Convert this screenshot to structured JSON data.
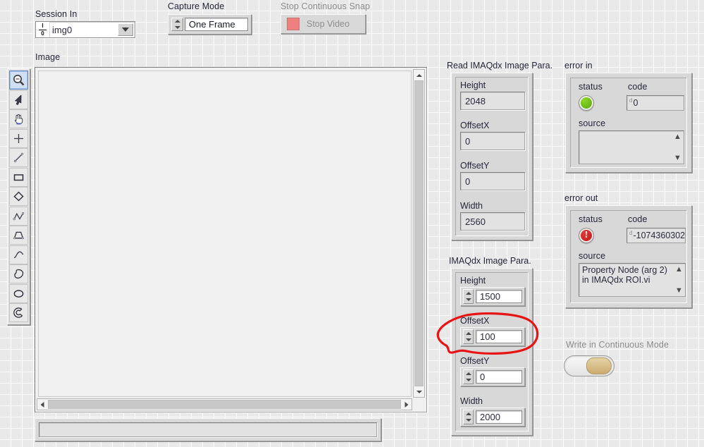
{
  "top_controls": {
    "session": {
      "label": "Session In",
      "value": "img0",
      "glyph": "io-refnum-icon",
      "dropdown_icon": "chevron-down-icon"
    },
    "capture_mode": {
      "label": "Capture Mode",
      "value": "One Frame",
      "increment_icon": "spinner-up-icon",
      "decrement_icon": "spinner-down-icon"
    },
    "stop_snap": {
      "label": "Stop Continuous Snap",
      "button_label": "Stop Video",
      "led_color": "#ef8080"
    }
  },
  "image_panel": {
    "label": "Image",
    "tools": [
      {
        "name": "zoom-tool",
        "selected": true
      },
      {
        "name": "selection-arrow-tool",
        "selected": false
      },
      {
        "name": "pan-hand-tool",
        "selected": false
      },
      {
        "name": "point-crosshair-tool",
        "selected": false
      },
      {
        "name": "line-tool",
        "selected": false
      },
      {
        "name": "rectangle-tool",
        "selected": false
      },
      {
        "name": "rotated-rectangle-tool",
        "selected": false
      },
      {
        "name": "polyline-tool",
        "selected": false
      },
      {
        "name": "polygon-tool",
        "selected": false
      },
      {
        "name": "freehand-line-tool",
        "selected": false
      },
      {
        "name": "freehand-region-tool",
        "selected": false
      },
      {
        "name": "oval-tool",
        "selected": false
      },
      {
        "name": "annulus-tool",
        "selected": false
      }
    ],
    "status_text": ""
  },
  "read_params": {
    "title": "Read IMAQdx Image Para.",
    "fields": [
      {
        "label": "Height",
        "value": "2048"
      },
      {
        "label": "OffsetX",
        "value": "0"
      },
      {
        "label": "OffsetY",
        "value": "0"
      },
      {
        "label": "Width",
        "value": "2560"
      }
    ]
  },
  "write_params": {
    "title": "IMAQdx Image Para.",
    "fields": [
      {
        "label": "Height",
        "value": "1500"
      },
      {
        "label": "OffsetX",
        "value": "100"
      },
      {
        "label": "OffsetY",
        "value": "0"
      },
      {
        "label": "Width",
        "value": "2000"
      }
    ]
  },
  "error_in": {
    "title": "error in",
    "status_label": "status",
    "status_state": "ok",
    "status_color": "#5fb800",
    "code_label": "code",
    "code_radix": "d",
    "code_value": "0",
    "source_label": "source",
    "source_value": ""
  },
  "error_out": {
    "title": "error out",
    "status_label": "status",
    "status_state": "error",
    "status_color": "#cc1818",
    "code_label": "code",
    "code_radix": "d",
    "code_value": "-1074360302",
    "source_label": "source",
    "source_line1": "Property Node (arg 2)",
    "source_line2": "in IMAQdx ROI.vi"
  },
  "continuous_mode": {
    "label": "Write in Continuous Mode",
    "state": "off",
    "knob_color": "#cbab6d"
  },
  "annotation": {
    "shape": "hand-drawn-ellipse",
    "color": "#e81414",
    "targets": "write_params.OffsetX"
  }
}
